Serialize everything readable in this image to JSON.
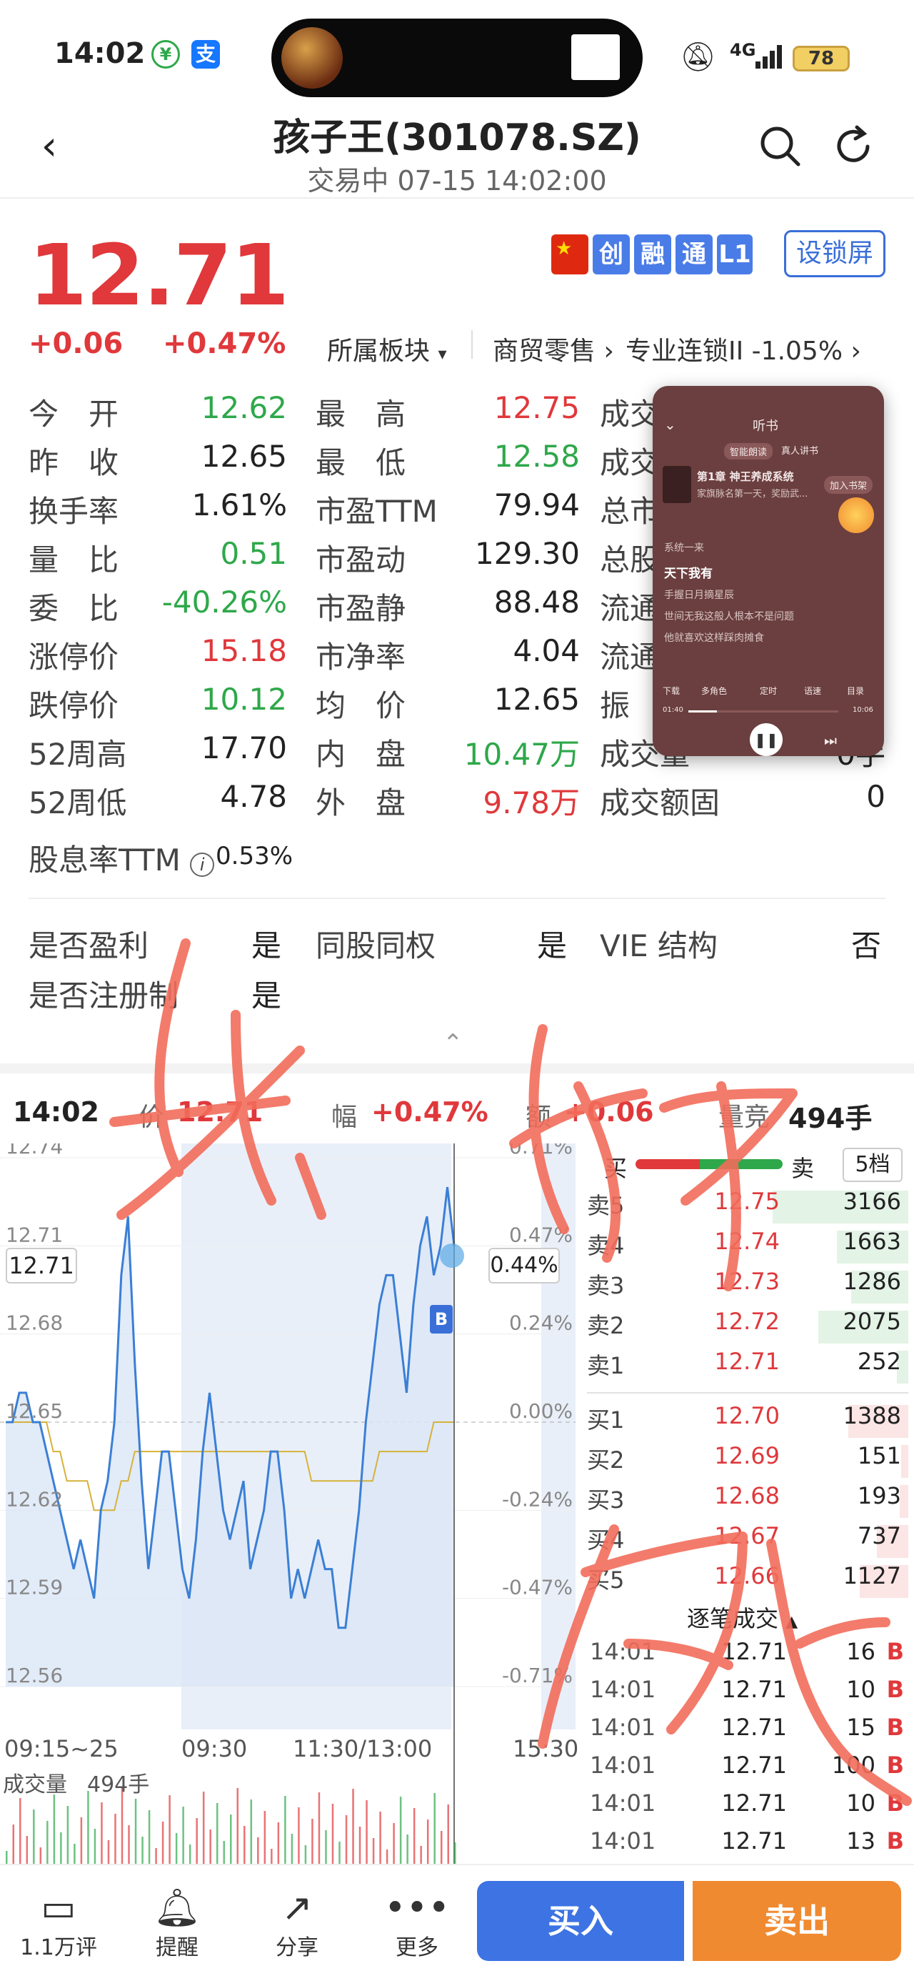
{
  "status": {
    "time": "14:02",
    "network": "4G",
    "battery": "78"
  },
  "header": {
    "title": "孩子王(301078.SZ)",
    "subtitle": "交易中 07-15 14:02:00"
  },
  "quote": {
    "price": "12.71",
    "change": "+0.06",
    "change_pct": "+0.47%",
    "sector_label": "所属板块",
    "sector1": "商贸零售",
    "sector2": "专业连锁II -1.05%",
    "badges": [
      "创",
      "融",
      "通",
      "L1"
    ],
    "lock_screen": "设锁屏"
  },
  "stats": [
    [
      {
        "label": "今　开",
        "value": "12.62",
        "color": "green"
      },
      {
        "label": "最　高",
        "value": "12.75",
        "color": "red"
      },
      {
        "label": "成交",
        "value": ""
      }
    ],
    [
      {
        "label": "昨　收",
        "value": "12.65",
        "color": "dark"
      },
      {
        "label": "最　低",
        "value": "12.58",
        "color": "green"
      },
      {
        "label": "成交",
        "value": ""
      }
    ],
    [
      {
        "label": "换手率",
        "value": "1.61%",
        "color": "dark"
      },
      {
        "label": "市盈TTM",
        "value": "79.94",
        "color": "dark"
      },
      {
        "label": "总市",
        "value": ""
      }
    ],
    [
      {
        "label": "量　比",
        "value": "0.51",
        "color": "green"
      },
      {
        "label": "市盈动",
        "value": "129.30",
        "color": "dark"
      },
      {
        "label": "总股",
        "value": ""
      }
    ],
    [
      {
        "label": "委　比",
        "value": "-40.26%",
        "color": "green"
      },
      {
        "label": "市盈静",
        "value": "88.48",
        "color": "dark"
      },
      {
        "label": "流通",
        "value": ""
      }
    ],
    [
      {
        "label": "涨停价",
        "value": "15.18",
        "color": "red"
      },
      {
        "label": "市净率",
        "value": "4.04",
        "color": "dark"
      },
      {
        "label": "流通",
        "value": ""
      }
    ],
    [
      {
        "label": "跌停价",
        "value": "10.12",
        "color": "green"
      },
      {
        "label": "均　价",
        "value": "12.65",
        "color": "dark"
      },
      {
        "label": "振",
        "value": ""
      }
    ],
    [
      {
        "label": "52周高",
        "value": "17.70",
        "color": "dark"
      },
      {
        "label": "内　盘",
        "value": "10.47万",
        "color": "green"
      },
      {
        "label": "成交量",
        "value": "0手"
      }
    ],
    [
      {
        "label": "52周低",
        "value": "4.78",
        "color": "dark"
      },
      {
        "label": "外　盘",
        "value": "9.78万",
        "color": "red"
      },
      {
        "label": "成交额固",
        "value": "0"
      }
    ]
  ],
  "dividend": {
    "label": "股息率TTM",
    "value": "0.53%"
  },
  "info": {
    "profit_label": "是否盈利",
    "profit": "是",
    "same_label": "同股同权",
    "same": "是",
    "vie_label": "VIE 结构",
    "vie": "否",
    "reg_label": "是否注册制",
    "reg": "是"
  },
  "player": {
    "header": "听书",
    "tab1": "智能朗读",
    "tab2": "真人讲书",
    "chapter": "第1章 神王养成系统",
    "desc": "家旗脉名第一天，奖励武...",
    "add_btn": "加入书架",
    "lines": [
      "系统一来",
      "天下我有",
      "手握日月摘星辰",
      "世间无我这般人根本不是问题",
      "他就喜欢这样踩肉摊食"
    ],
    "controls": [
      "下载",
      "多角色",
      "定时",
      "语速",
      "目录"
    ],
    "t_start": "01:40",
    "t_end": "10:06"
  },
  "chart_bar": {
    "time": "14:02",
    "price_lbl": "价",
    "price": "12.71",
    "pct_lbl": "幅",
    "pct": "+0.47%",
    "chg_lbl": "额",
    "chg": "+0.06",
    "vol_lbl": "量竞",
    "vol": "494手"
  },
  "chart_data": {
    "type": "line",
    "ylim": [
      12.56,
      12.74
    ],
    "yticks": [
      "12.74",
      "12.71",
      "12.68",
      "12.65",
      "12.62",
      "12.59",
      "12.56"
    ],
    "pct_ticks": [
      "0.71%",
      "0.47%",
      "0.24%",
      "0.00%",
      "-0.24%",
      "-0.47%",
      "-0.71%"
    ],
    "xlabels": [
      "09:15~25",
      "09:30",
      "11:30/13:00",
      "15:30"
    ],
    "current": "12.71",
    "current_pct": "0.44%",
    "prev_close": 12.65,
    "price": [
      12.65,
      12.65,
      12.66,
      12.66,
      12.65,
      12.65,
      12.64,
      12.63,
      12.62,
      12.61,
      12.6,
      12.61,
      12.6,
      12.59,
      12.62,
      12.63,
      12.65,
      12.7,
      12.72,
      12.67,
      12.63,
      12.6,
      12.62,
      12.64,
      12.64,
      12.62,
      12.6,
      12.59,
      12.61,
      12.64,
      12.66,
      12.64,
      12.62,
      12.61,
      12.62,
      12.63,
      12.6,
      12.61,
      12.62,
      12.64,
      12.64,
      12.62,
      12.59,
      12.6,
      12.59,
      12.6,
      12.61,
      12.6,
      12.6,
      12.58,
      12.58,
      12.6,
      12.62,
      12.65,
      12.67,
      12.69,
      12.7,
      12.7,
      12.68,
      12.66,
      12.69,
      12.71,
      12.72,
      12.7,
      12.71,
      12.73,
      12.71
    ],
    "avg": [
      12.65,
      12.65,
      12.65,
      12.65,
      12.65,
      12.65,
      12.65,
      12.64,
      12.64,
      12.63,
      12.63,
      12.63,
      12.63,
      12.62,
      12.62,
      12.62,
      12.62,
      12.63,
      12.63,
      12.64,
      12.64,
      12.64,
      12.64,
      12.64,
      12.64,
      12.64,
      12.64,
      12.64,
      12.64,
      12.64,
      12.64,
      12.64,
      12.64,
      12.64,
      12.64,
      12.64,
      12.64,
      12.64,
      12.64,
      12.64,
      12.64,
      12.64,
      12.64,
      12.64,
      12.64,
      12.63,
      12.63,
      12.63,
      12.63,
      12.63,
      12.63,
      12.63,
      12.63,
      12.63,
      12.63,
      12.64,
      12.64,
      12.64,
      12.64,
      12.64,
      12.64,
      12.64,
      12.64,
      12.65,
      12.65,
      12.65,
      12.65
    ],
    "volume_label": "成交量",
    "volume": "494手"
  },
  "orderbook": {
    "buy_lbl": "买",
    "sell_lbl": "卖",
    "levels": "5档",
    "asks": [
      {
        "label": "卖5",
        "price": "12.75",
        "vol": "3166",
        "bar": 0.95
      },
      {
        "label": "卖4",
        "price": "12.74",
        "vol": "1663",
        "bar": 0.5
      },
      {
        "label": "卖3",
        "price": "12.73",
        "vol": "1286",
        "bar": 0.4
      },
      {
        "label": "卖2",
        "price": "12.72",
        "vol": "2075",
        "bar": 0.63
      },
      {
        "label": "卖1",
        "price": "12.71",
        "vol": "252",
        "bar": 0.08
      }
    ],
    "bids": [
      {
        "label": "买1",
        "price": "12.70",
        "vol": "1388",
        "bar": 0.42
      },
      {
        "label": "买2",
        "price": "12.69",
        "vol": "151",
        "bar": 0.05
      },
      {
        "label": "买3",
        "price": "12.68",
        "vol": "193",
        "bar": 0.06
      },
      {
        "label": "买4",
        "price": "12.67",
        "vol": "737",
        "bar": 0.22
      },
      {
        "label": "买5",
        "price": "12.66",
        "vol": "1127",
        "bar": 0.34
      }
    ],
    "trades_label": "逐笔成交",
    "trades": [
      {
        "time": "14:01",
        "price": "12.71",
        "vol": "16",
        "dir": "B"
      },
      {
        "time": "14:01",
        "price": "12.71",
        "vol": "10",
        "dir": "B"
      },
      {
        "time": "14:01",
        "price": "12.71",
        "vol": "15",
        "dir": "B"
      },
      {
        "time": "14:01",
        "price": "12.71",
        "vol": "100",
        "dir": "B"
      },
      {
        "time": "14:01",
        "price": "12.71",
        "vol": "10",
        "dir": "B"
      },
      {
        "time": "14:01",
        "price": "12.71",
        "vol": "13",
        "dir": "B"
      }
    ]
  },
  "bottom": {
    "comment": "1.1万评",
    "alert": "提醒",
    "share": "分享",
    "more": "更多",
    "buy": "买入",
    "sell": "卖出"
  },
  "colors": {
    "red": "#e0383b",
    "green": "#2ea84a",
    "blue": "#3d73e3",
    "orange": "#f08a31",
    "scribble": "#f26d5b"
  }
}
